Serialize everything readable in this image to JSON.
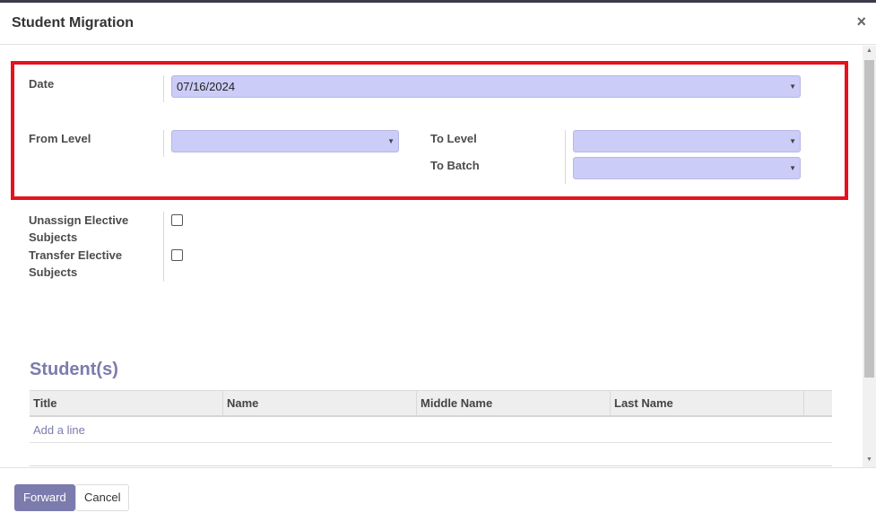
{
  "dialog": {
    "title": "Student Migration",
    "close_glyph": "×"
  },
  "form": {
    "date_label": "Date",
    "date_value": "07/16/2024",
    "from_level_label": "From Level",
    "from_level_value": "",
    "to_level_label": "To Level",
    "to_level_value": "",
    "to_batch_label": "To Batch",
    "to_batch_value": "",
    "unassign_label_line1": "Unassign Elective",
    "unassign_label_line2": "Subjects",
    "transfer_label_line1": "Transfer Elective",
    "transfer_label_line2": "Subjects",
    "unassign_checked": false,
    "transfer_checked": false
  },
  "students": {
    "section_title": "Student(s)",
    "columns": [
      "Title",
      "Name",
      "Middle Name",
      "Last Name"
    ],
    "add_line": "Add a line"
  },
  "footer": {
    "forward_label": "Forward",
    "cancel_label": "Cancel"
  },
  "colors": {
    "accent": "#7c7bad",
    "highlight_border": "#e5121e",
    "field_bg": "#ccccf9"
  }
}
